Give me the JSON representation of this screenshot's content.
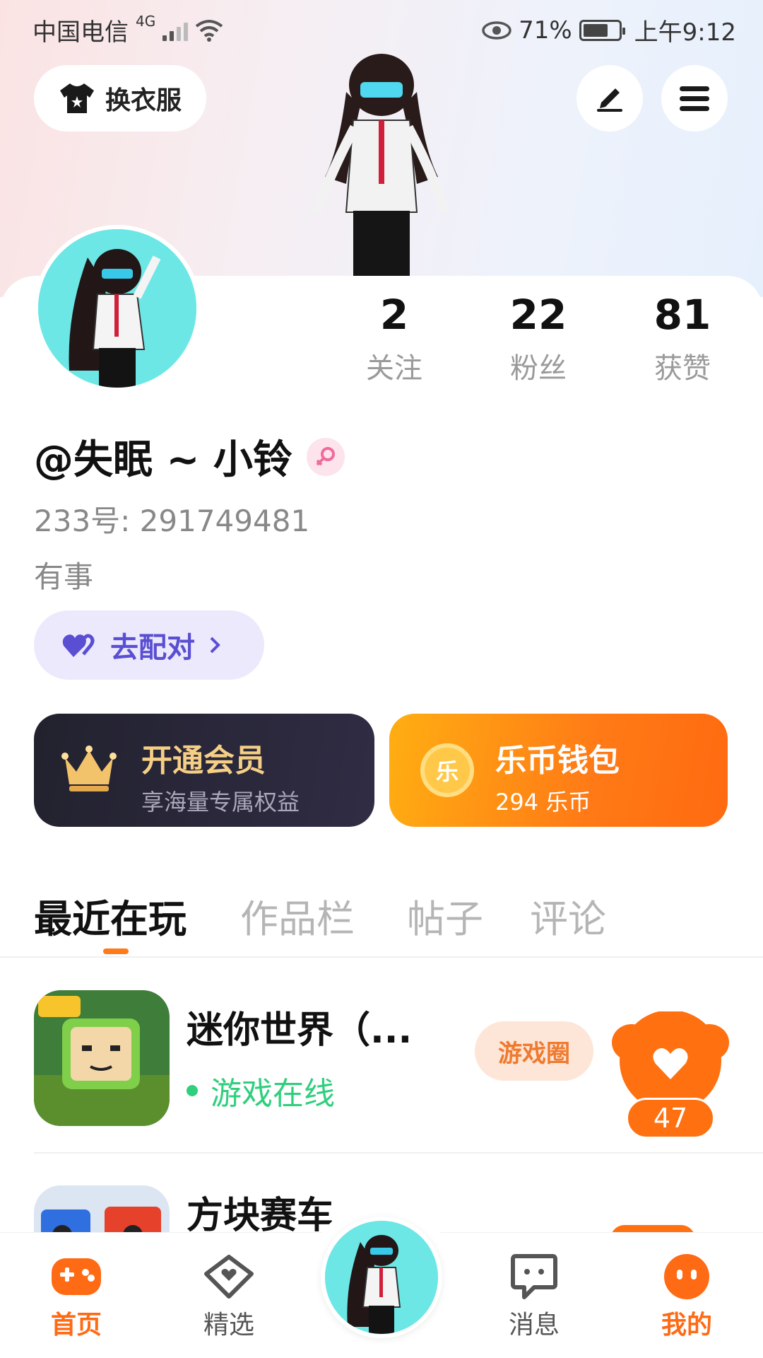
{
  "status_bar": {
    "carrier": "中国电信",
    "network": "4G",
    "battery_percent": "71%",
    "battery_level": 0.71,
    "time": "上午9:12"
  },
  "header": {
    "outfit_label": "换衣服",
    "edit_icon": "pen-icon",
    "menu_icon": "menu-icon"
  },
  "stats": [
    {
      "value": "2",
      "label": "关注"
    },
    {
      "value": "22",
      "label": "粉丝"
    },
    {
      "value": "81",
      "label": "获赞"
    }
  ],
  "profile": {
    "username": "@失眠 ~ 小铃",
    "gender_icon": "female-icon",
    "uid": "233号:  291749481",
    "bio": "有事",
    "match_label": "去配对"
  },
  "cards": {
    "vip": {
      "title": "开通会员",
      "subtitle": "享海量专属权益"
    },
    "wallet": {
      "title": "乐币钱包",
      "subtitle": "294 乐币",
      "coin_glyph": "乐"
    }
  },
  "tabs": [
    {
      "label": "最近在玩",
      "active": true
    },
    {
      "label": "作品栏",
      "active": false
    },
    {
      "label": "帖子",
      "active": false
    },
    {
      "label": "评论",
      "active": false
    }
  ],
  "games": [
    {
      "name": "迷你世界（...",
      "status": "游戏在线",
      "circle_label": "游戏圈",
      "likes": "47"
    },
    {
      "name": "方块赛车"
    }
  ],
  "navbar": [
    {
      "label": "首页",
      "icon": "gamepad-icon"
    },
    {
      "label": "精选",
      "icon": "heart-chat-icon"
    },
    {
      "label": "消息",
      "icon": "message-icon"
    },
    {
      "label": "我的",
      "icon": "face-icon"
    }
  ],
  "colors": {
    "accent": "#ff7a1a",
    "online": "#2fcf7e",
    "match": "#5a4fd2"
  }
}
